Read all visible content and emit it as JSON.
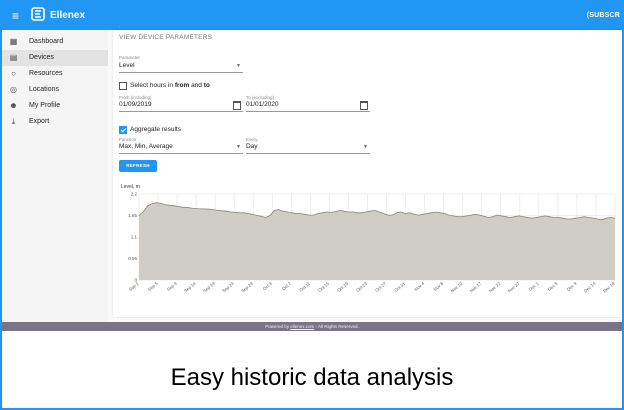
{
  "app": {
    "brand": "Ellenex",
    "subscribe": "(SUBSCR"
  },
  "sidebar": {
    "items": [
      {
        "label": "Dashboard",
        "icon": "dashboard-icon"
      },
      {
        "label": "Devices",
        "icon": "devices-icon",
        "active": true
      },
      {
        "label": "Resources",
        "icon": "resources-icon"
      },
      {
        "label": "Locations",
        "icon": "locations-icon"
      },
      {
        "label": "My Profile",
        "icon": "profile-icon"
      },
      {
        "label": "Export",
        "icon": "export-icon"
      }
    ]
  },
  "form": {
    "title": "VIEW DEVICE PARAMETERS",
    "parameter_label": "Parameter",
    "parameter_value": "Level",
    "select_hours_pre": "Select hours in ",
    "select_hours_from": "from",
    "select_hours_mid": " and ",
    "select_hours_to": "to",
    "select_hours_checked": false,
    "from_label": "From (including)",
    "from_value": "01/09/2019",
    "to_label": "To (excluding)",
    "to_value": "01/01/2020",
    "aggregate_label": "Aggregate results",
    "aggregate_checked": true,
    "function_label": "Function",
    "function_value": "Max, Min, Average",
    "every_label": "Every",
    "every_value": "Day",
    "refresh_label": "REFRESH"
  },
  "footer": {
    "pre": "Powered by ",
    "link": "ellenex.com",
    "post": " - All Rights Reserved."
  },
  "caption": "Easy historic data analysis",
  "chart_data": {
    "type": "area",
    "ylabel": "Level, m",
    "yticks": [
      "0",
      "0.55",
      "1.1",
      "1.65",
      "2.2"
    ],
    "ylim": [
      0,
      2.2
    ],
    "x_tick_labels": [
      "Sep 1",
      "Sep 5",
      "Sep 9",
      "Sep 14",
      "Sep 19",
      "Sep 24",
      "Sep 29",
      "Oct 3",
      "Oct 7",
      "Oct 11",
      "Oct 15",
      "Oct 19",
      "Oct 23",
      "Oct 27",
      "Oct 31",
      "Nov 4",
      "Nov 8",
      "Nov 12",
      "Nov 17",
      "Nov 22",
      "Nov 27",
      "Dec 1",
      "Dec 5",
      "Dec 9",
      "Dec 14",
      "Dec 18"
    ],
    "x_start": "2019-09-01",
    "x_end": "2019-12-20",
    "grid": true,
    "fill_color": "#cfcdc6",
    "line_color": "#8a8675",
    "series": [
      {
        "values": [
          1.65,
          1.75,
          1.9,
          1.95,
          1.98,
          1.96,
          1.93,
          1.91,
          1.9,
          1.88,
          1.86,
          1.86,
          1.84,
          1.83,
          1.82,
          1.82,
          1.81,
          1.8,
          1.78,
          1.77,
          1.76,
          1.74,
          1.73,
          1.72,
          1.72,
          1.7,
          1.68,
          1.65,
          1.63,
          1.6,
          1.65,
          1.78,
          1.8,
          1.76,
          1.74,
          1.72,
          1.7,
          1.7,
          1.68,
          1.66,
          1.66,
          1.7,
          1.72,
          1.74,
          1.73,
          1.75,
          1.78,
          1.76,
          1.74,
          1.74,
          1.72,
          1.72,
          1.74,
          1.76,
          1.78,
          1.74,
          1.7,
          1.66,
          1.66,
          1.72,
          1.74,
          1.7,
          1.72,
          1.68,
          1.66,
          1.68,
          1.7,
          1.72,
          1.74,
          1.72,
          1.7,
          1.66,
          1.64,
          1.62,
          1.62,
          1.64,
          1.66,
          1.68,
          1.66,
          1.63,
          1.6,
          1.62,
          1.66,
          1.64,
          1.62,
          1.6,
          1.62,
          1.64,
          1.62,
          1.6,
          1.58,
          1.6,
          1.62,
          1.64,
          1.62,
          1.6,
          1.6,
          1.58,
          1.56,
          1.56,
          1.58,
          1.6,
          1.62,
          1.6,
          1.58,
          1.56,
          1.54,
          1.58,
          1.6,
          1.58
        ]
      }
    ]
  }
}
